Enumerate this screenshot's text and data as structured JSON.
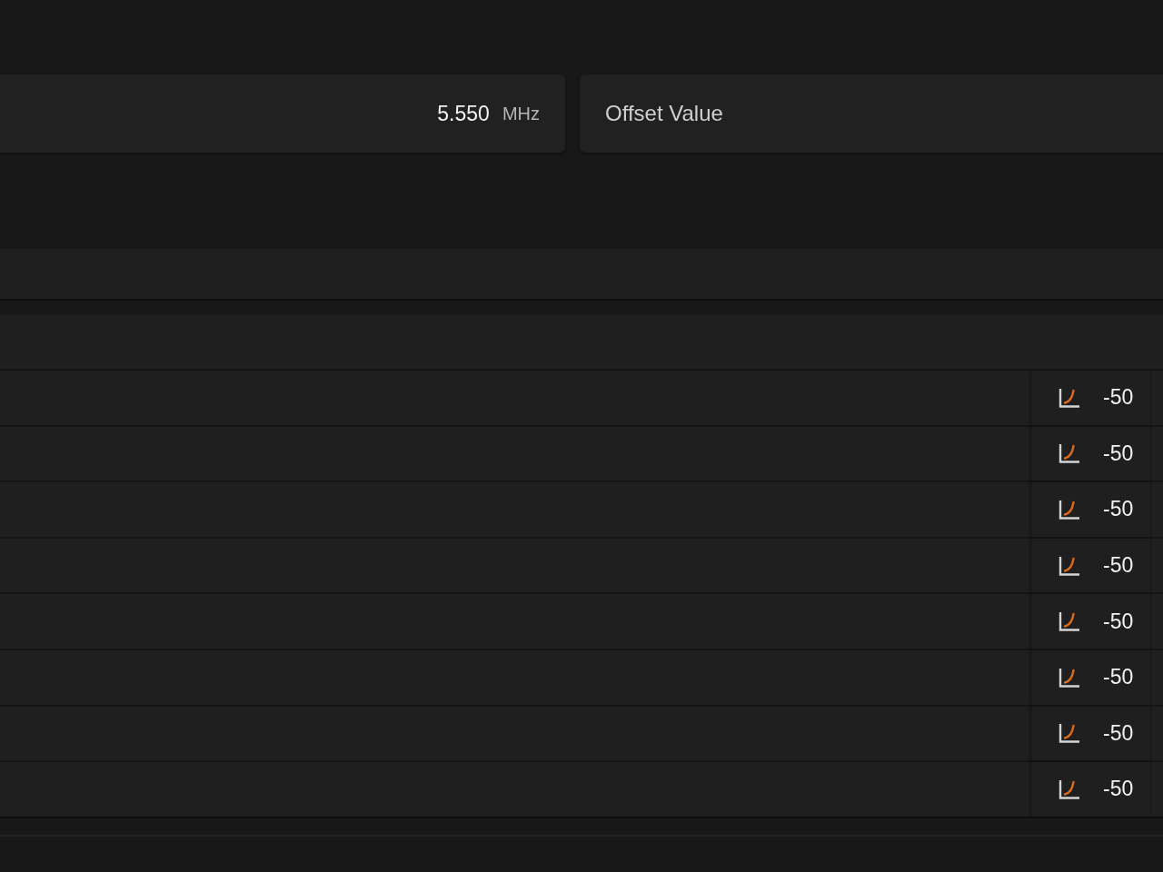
{
  "frequency_field": {
    "value": "5.550",
    "unit": "MHz"
  },
  "offset_field": {
    "placeholder": "Offset Value"
  },
  "table": {
    "rows": [
      {
        "value": "-50"
      },
      {
        "value": "-50"
      },
      {
        "value": "-50"
      },
      {
        "value": "-50"
      },
      {
        "value": "-50"
      },
      {
        "value": "-50"
      },
      {
        "value": "-50"
      },
      {
        "value": "-50"
      }
    ]
  }
}
